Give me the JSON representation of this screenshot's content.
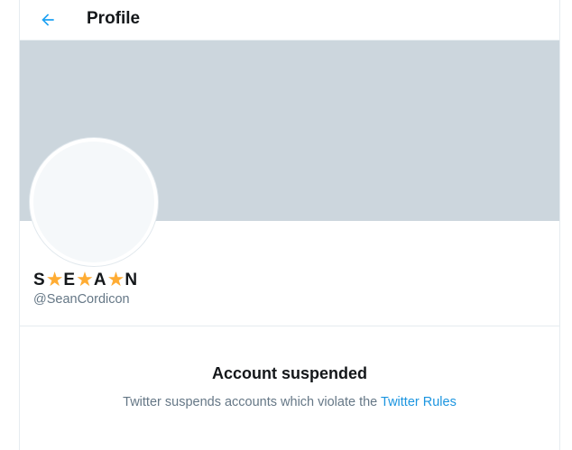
{
  "header": {
    "back_icon": "arrow-left-icon",
    "title": "Profile"
  },
  "profile": {
    "name_parts": [
      "S",
      "★",
      "E",
      "★",
      "A",
      "★",
      "N"
    ],
    "handle": "@SeanCordicon"
  },
  "notice": {
    "title": "Account suspended",
    "text": "Twitter suspends accounts which violate the ",
    "link_label": "Twitter Rules"
  },
  "colors": {
    "accent": "#1da1f2",
    "banner": "#ccd6dd",
    "star": "#ffac33"
  }
}
